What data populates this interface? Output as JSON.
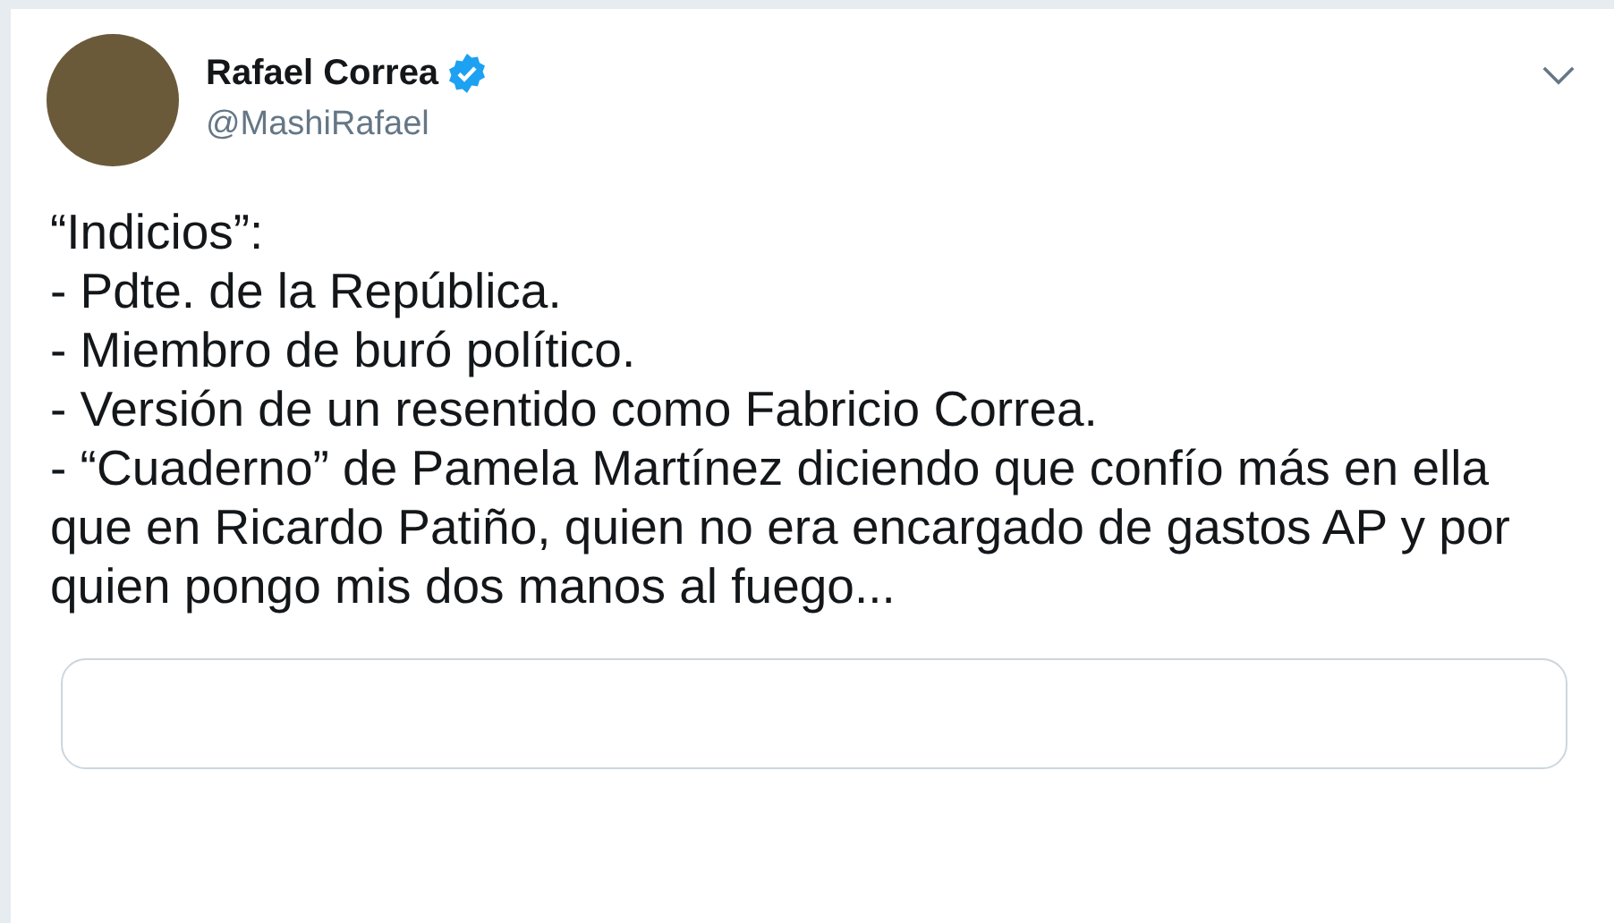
{
  "tweet": {
    "author": {
      "name": "Rafael Correa",
      "verified": true,
      "handle": "@MashiRafael"
    },
    "text": "“Indicios”:\n- Pdte. de la República.\n- Miembro de buró político.\n- Versión de un resentido como Fabricio Correa.\n- “Cuaderno” de Pamela Martínez diciendo que confío más en ella que en Ricardo Patiño, quien no era encargado de gastos AP y por quien pongo mis dos manos al fuego..."
  }
}
